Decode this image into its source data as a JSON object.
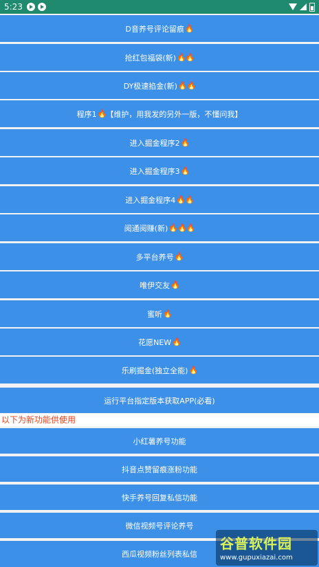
{
  "status_bar": {
    "time": "5:23"
  },
  "buttons": [
    {
      "label": "D音养号评论留痕",
      "flames": "🔥"
    },
    {
      "label": "抢红包福袋(新)",
      "flames": "🔥🔥"
    },
    {
      "label": "DY极速掐金(新)",
      "flames": "🔥🔥"
    },
    {
      "label": "程序1",
      "flames": "🔥",
      "suffix": "【维护，用我发的另外一版，不懂问我】"
    },
    {
      "label": "进入掘金程序2",
      "flames": "🔥"
    },
    {
      "label": "进入掘金程序3",
      "flames": "🔥"
    },
    {
      "label": "进入掘金程序4",
      "flames": "🔥🔥"
    },
    {
      "label": "阅通阅赚(新)",
      "flames": "🔥🔥🔥"
    },
    {
      "label": "多平台养号",
      "flames": "🔥"
    },
    {
      "label": "唯伊交友",
      "flames": "🔥"
    },
    {
      "label": "蜜听",
      "flames": "🔥"
    },
    {
      "label": "花愿NEW",
      "flames": "🔥"
    },
    {
      "label": "乐刷掘金(独立全能)",
      "flames": "🔥"
    },
    {
      "label": "运行平台指定版本获取APP(必看)",
      "flames": ""
    }
  ],
  "notice": "以下为新功能供使用",
  "new_buttons": [
    {
      "label": "小红薯养号功能"
    },
    {
      "label": "抖音点赞留痕涨粉功能"
    },
    {
      "label": "快手养号回复私信功能"
    },
    {
      "label": "微信视频号评论养号"
    },
    {
      "label": "西瓜视频粉丝列表私信"
    }
  ],
  "watermark": {
    "title": "谷普软件园",
    "url": "www.gupuxiazai.com"
  }
}
